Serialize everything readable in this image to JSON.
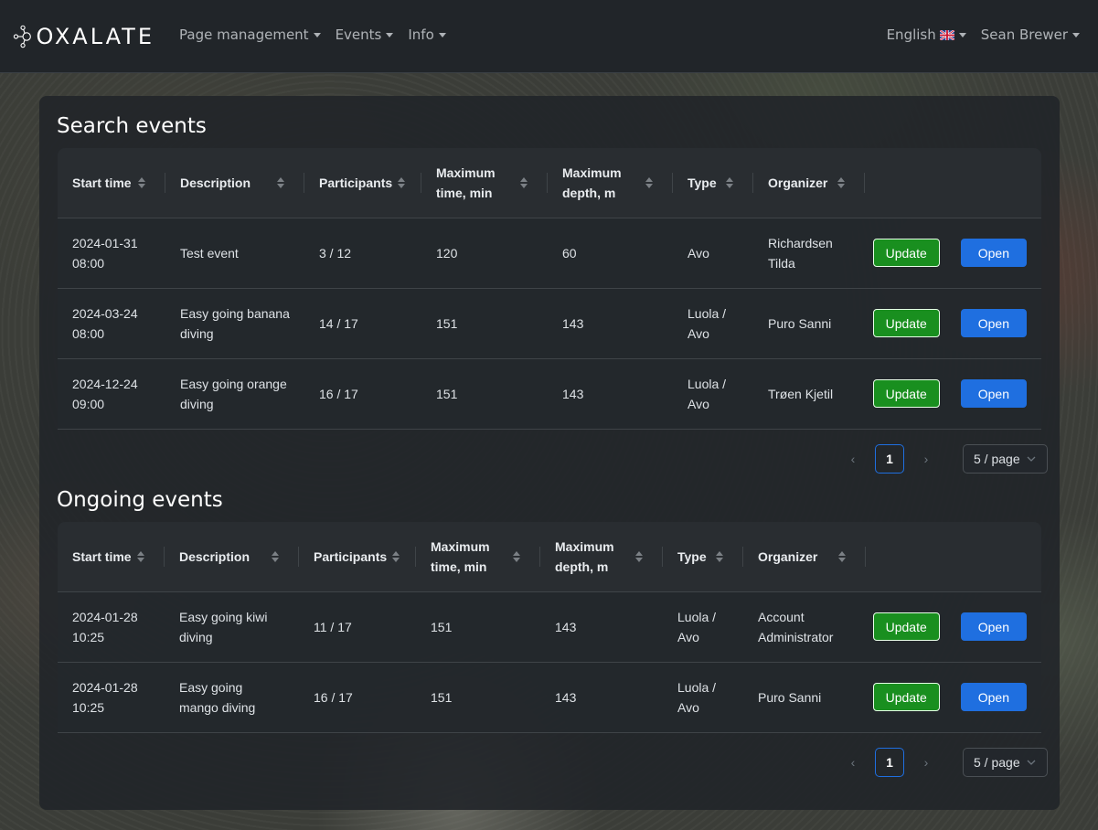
{
  "nav": {
    "brand": "OXALATE",
    "menus": [
      "Page management",
      "Events",
      "Info"
    ],
    "language": "English",
    "user": "Sean Brewer"
  },
  "columns": [
    "Start time",
    "Description",
    "Participants",
    "Maximum time, min",
    "Maximum depth, m",
    "Type",
    "Organizer"
  ],
  "buttons": {
    "update": "Update",
    "open": "Open"
  },
  "search": {
    "title": "Search events",
    "rows": [
      {
        "start": "2024-01-31 08:00",
        "description": "Test event",
        "participants": "3 / 12",
        "max_time": "120",
        "max_depth": "60",
        "type": "Avo",
        "organizer": "Richardsen Tilda"
      },
      {
        "start": "2024-03-24 08:00",
        "description": "Easy going banana diving",
        "participants": "14 / 17",
        "max_time": "151",
        "max_depth": "143",
        "type": "Luola / Avo",
        "organizer": "Puro Sanni"
      },
      {
        "start": "2024-12-24 09:00",
        "description": "Easy going orange diving",
        "participants": "16 / 17",
        "max_time": "151",
        "max_depth": "143",
        "type": "Luola / Avo",
        "organizer": "Trøen Kjetil"
      }
    ],
    "page": "1",
    "page_size": "5 / page"
  },
  "ongoing": {
    "title": "Ongoing events",
    "rows": [
      {
        "start": "2024-01-28 10:25",
        "description": "Easy going kiwi diving",
        "participants": "11 / 17",
        "max_time": "151",
        "max_depth": "143",
        "type": "Luola / Avo",
        "organizer": "Account Administrator"
      },
      {
        "start": "2024-01-28 10:25",
        "description": "Easy going mango diving",
        "participants": "16 / 17",
        "max_time": "151",
        "max_depth": "143",
        "type": "Luola / Avo",
        "organizer": "Puro Sanni"
      }
    ],
    "page": "1",
    "page_size": "5 / page"
  }
}
